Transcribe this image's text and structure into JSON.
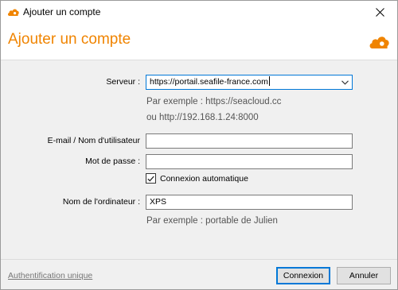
{
  "window": {
    "title": "Ajouter un compte",
    "icon": "seafile-cloud-icon",
    "close_glyph": "✕"
  },
  "header": {
    "title": "Ajouter un compte",
    "logo": "seafile-cloud-icon",
    "accent_color": "#f08400"
  },
  "form": {
    "server": {
      "label": "Serveur :",
      "value": "https://portail.seafile-france.com",
      "hint_line1": "Par exemple : https://seacloud.cc",
      "hint_line2": "ou http://192.168.1.24:8000"
    },
    "email": {
      "label": "E-mail / Nom d'utilisateur",
      "value": ""
    },
    "password": {
      "label": "Mot de passe :",
      "value": ""
    },
    "auto_login": {
      "label": "Connexion automatique",
      "checked": true
    },
    "computer_name": {
      "label": "Nom de l'ordinateur :",
      "value": "XPS",
      "hint": "Par exemple : portable de Julien"
    }
  },
  "footer": {
    "sso_link": "Authentification unique",
    "connect_button": "Connexion",
    "cancel_button": "Annuler"
  }
}
